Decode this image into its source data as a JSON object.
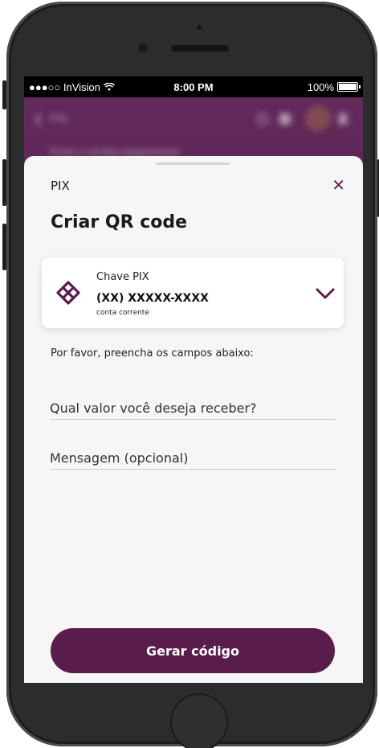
{
  "status_bar": {
    "carrier": "●●●○○ InVision",
    "time": "8:00 PM",
    "battery": "100%"
  },
  "background_screen": {
    "title": "PIX",
    "subtitle": "Envie e receba pagamentos"
  },
  "sheet": {
    "breadcrumb": "PIX",
    "close_icon": "close-icon",
    "title": "Criar QR code",
    "key_card": {
      "label": "Chave PIX",
      "value": "(XX) XXXXX-XXXX",
      "account": "conta corrente",
      "icon": "pix-icon",
      "chevron": "chevron-down-icon"
    },
    "hint": "Por favor, preencha os campos abaixo:",
    "fields": {
      "amount_placeholder": "Qual valor você deseja receber?",
      "message_placeholder": "Mensagem (opcional)"
    },
    "cta_label": "Gerar código"
  },
  "colors": {
    "brand": "#5a1d4b",
    "app_header": "#612a5a",
    "sheet_bg": "#f6f6f6"
  }
}
